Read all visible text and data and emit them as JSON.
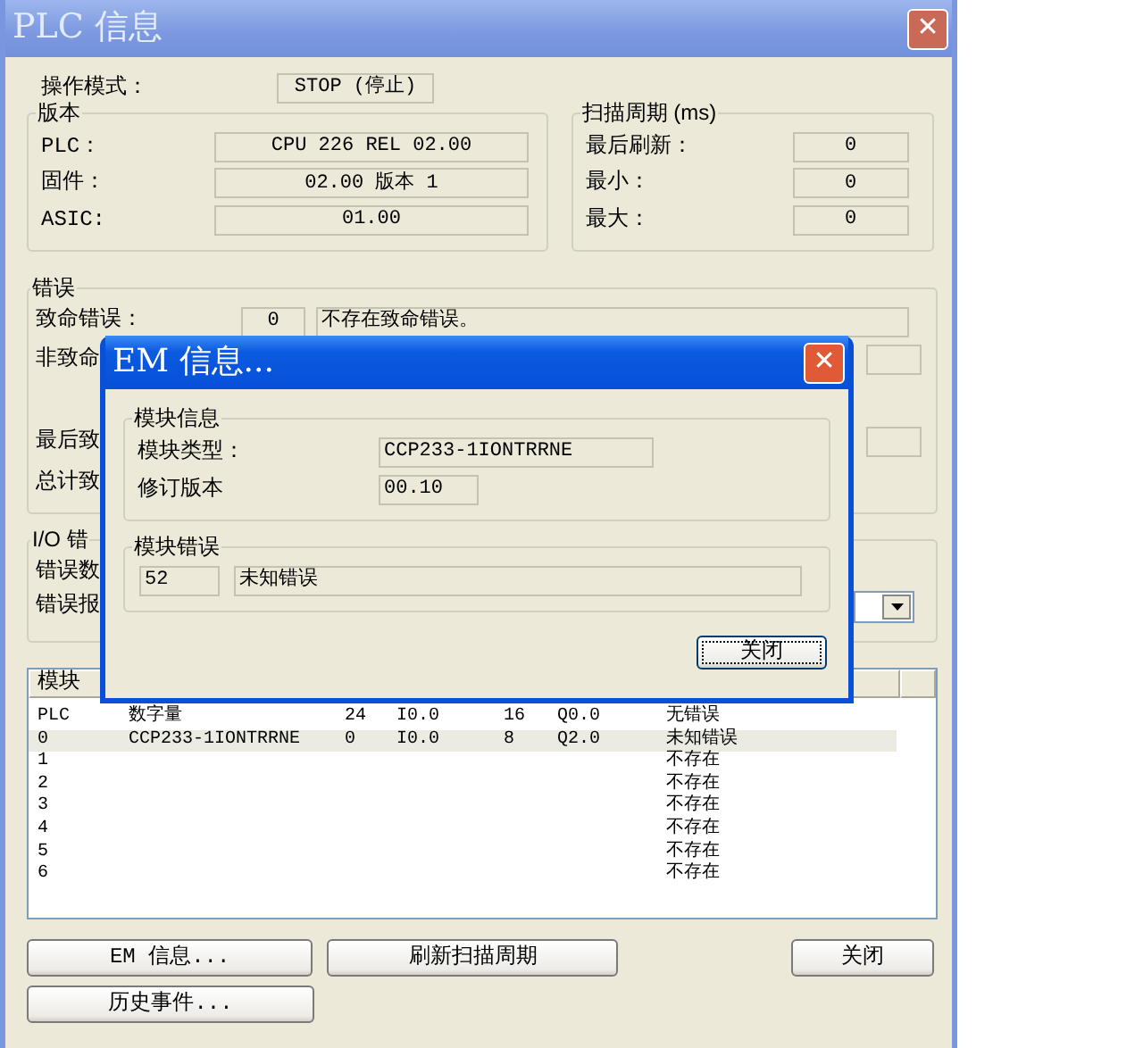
{
  "window": {
    "title": "PLC 信息",
    "close": "✕"
  },
  "mode": {
    "label": "操作模式：",
    "value": "STOP (停止)"
  },
  "version": {
    "title": "版本",
    "rows": [
      {
        "label": "PLC：",
        "value": "CPU 226 REL 02.00"
      },
      {
        "label": "固件：",
        "value": "02.00 版本 1"
      },
      {
        "label": "ASIC:",
        "value": "01.00"
      }
    ]
  },
  "scan": {
    "title": "扫描周期 (ms)",
    "rows": [
      {
        "label": "最后刷新：",
        "value": "0"
      },
      {
        "label": "最小：",
        "value": "0"
      },
      {
        "label": "最大：",
        "value": "0"
      }
    ]
  },
  "errors": {
    "title": "错误",
    "fatal": {
      "label": "致命错误：",
      "code": "0",
      "text": "不存在致命错误。"
    },
    "nonfatal": {
      "label": "非致命"
    },
    "last": {
      "label": "最后致"
    },
    "total": {
      "label": "总计致"
    }
  },
  "io_errors": {
    "title": "I/O 错",
    "count": {
      "label": "错误数"
    },
    "report": {
      "label": "错误报"
    }
  },
  "modules": {
    "columns": [
      {
        "label": "模块"
      }
    ],
    "rows": [
      {
        "cells": [
          "PLC",
          "数字量",
          "24",
          "I0.0",
          "16",
          "Q0.0",
          "无错误"
        ],
        "selected": false
      },
      {
        "cells": [
          "0",
          "CCP233-1IONTRRNE",
          "0",
          "I0.0",
          "8",
          "Q2.0",
          "未知错误"
        ],
        "selected": true
      },
      {
        "cells": [
          "1",
          "",
          "",
          "",
          "",
          "",
          "不存在"
        ],
        "selected": false
      },
      {
        "cells": [
          "2",
          "",
          "",
          "",
          "",
          "",
          "不存在"
        ],
        "selected": false
      },
      {
        "cells": [
          "3",
          "",
          "",
          "",
          "",
          "",
          "不存在"
        ],
        "selected": false
      },
      {
        "cells": [
          "4",
          "",
          "",
          "",
          "",
          "",
          "不存在"
        ],
        "selected": false
      },
      {
        "cells": [
          "5",
          "",
          "",
          "",
          "",
          "",
          "不存在"
        ],
        "selected": false
      },
      {
        "cells": [
          "6",
          "",
          "",
          "",
          "",
          "",
          "不存在"
        ],
        "selected": false
      }
    ]
  },
  "buttons": [
    {
      "label": "EM 信息..."
    },
    {
      "label": "刷新扫描周期"
    },
    {
      "label": "关闭"
    },
    {
      "label": "历史事件..."
    }
  ],
  "dialog": {
    "title": "EM 信息...",
    "close": "✕",
    "info": {
      "title": "模块信息",
      "type_label": "模块类型：",
      "type_value": "CCP233-1IONTRRNE",
      "rev_label": "修订版本",
      "rev_value": "00.10"
    },
    "error": {
      "title": "模块错误",
      "code": "52",
      "text": "未知错误"
    },
    "button": {
      "label": "关闭",
      "focused": true
    }
  }
}
